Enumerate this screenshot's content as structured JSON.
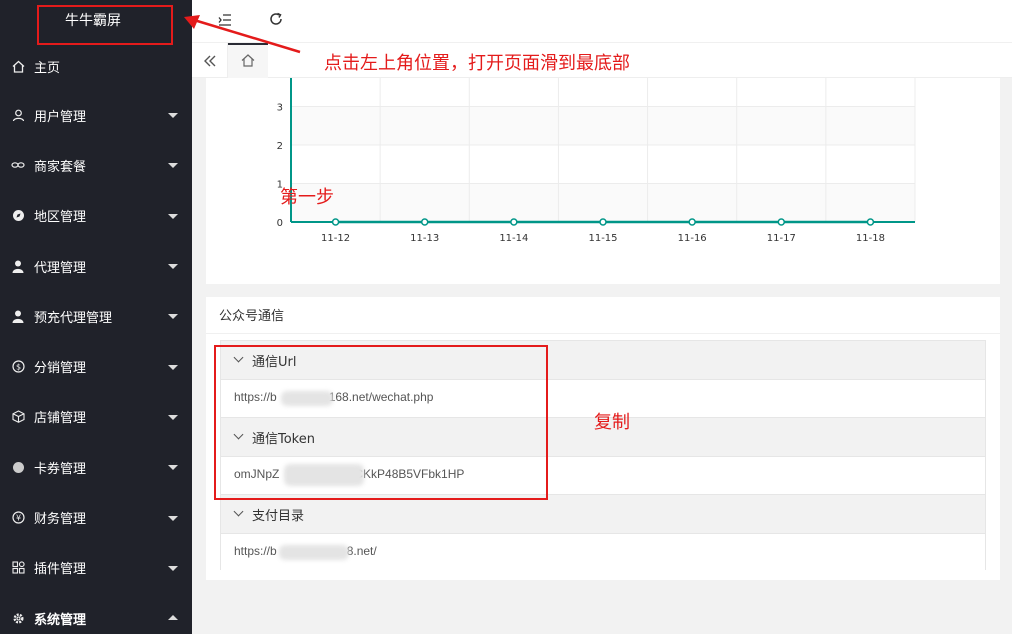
{
  "app": {
    "logo_text": "牛牛霸屏"
  },
  "sidebar": {
    "items": [
      {
        "label": "主页",
        "icon": "home-icon",
        "expanded": false
      },
      {
        "label": "用户管理",
        "icon": "user-icon",
        "expanded": false
      },
      {
        "label": "商家套餐",
        "icon": "link-icon",
        "expanded": false
      },
      {
        "label": "地区管理",
        "icon": "compass-icon",
        "expanded": false
      },
      {
        "label": "代理管理",
        "icon": "person-icon",
        "expanded": false
      },
      {
        "label": "预充代理管理",
        "icon": "person-icon",
        "expanded": false
      },
      {
        "label": "分销管理",
        "icon": "dollar-icon",
        "expanded": false
      },
      {
        "label": "店铺管理",
        "icon": "cube-icon",
        "expanded": false
      },
      {
        "label": "卡券管理",
        "icon": "circle-icon",
        "expanded": false
      },
      {
        "label": "财务管理",
        "icon": "yen-icon",
        "expanded": false
      },
      {
        "label": "插件管理",
        "icon": "app-icon",
        "expanded": false
      },
      {
        "label": "系统管理",
        "icon": "gear-icon",
        "expanded": true
      }
    ]
  },
  "header": {
    "menu_icon": "menu-fold-icon",
    "refresh_icon": "refresh-icon"
  },
  "tabbar": {
    "prev_icon": "double-chevron-left-icon",
    "home_icon": "home-icon"
  },
  "chart_data": {
    "type": "line",
    "categories": [
      "11-12",
      "11-13",
      "11-14",
      "11-15",
      "11-16",
      "11-17",
      "11-18"
    ],
    "series": [
      {
        "values": [
          0,
          0,
          0,
          0,
          0,
          0,
          0
        ]
      }
    ],
    "y_ticks": [
      "0",
      "1",
      "2",
      "3"
    ],
    "ylim": [
      0,
      3
    ],
    "grid": true,
    "color": "#009688"
  },
  "panel": {
    "title": "公众号通信",
    "sections": [
      {
        "title": "通信Url",
        "value": "https://b██████168.net/wechat.php",
        "value_prefix": "https://b",
        "value_suffix": "168.net/wechat.php"
      },
      {
        "title": "通信Token",
        "value_prefix": "omJNpZ",
        "value_suffix": "CKkP48B5VFbk1HP"
      },
      {
        "title": "支付目录",
        "value_prefix": "https://b",
        "value_suffix": "8.net/"
      }
    ]
  },
  "annotations": {
    "top": "点击左上角位置，打开页面滑到最底部",
    "step1": "第一步",
    "copy": "复制"
  },
  "colors": {
    "sidebar_bg": "#20222a",
    "accent": "#009688",
    "annotation": "#e41b1b"
  }
}
